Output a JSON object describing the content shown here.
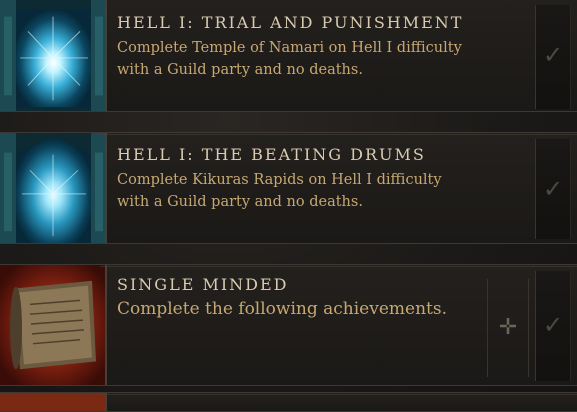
{
  "achievements": [
    {
      "title": "Hell I: Trial and Punishment",
      "description": "Complete Temple of Namari on Hell I difficulty with a Guild party and no deaths.",
      "icon": "portal-icon",
      "completed_icon": "checkmark-icon",
      "check_glyph": "✓"
    },
    {
      "title": "Hell I: The Beating Drums",
      "description": "Complete Kikuras Rapids on Hell I difficulty with a Guild party and no deaths.",
      "icon": "portal-icon",
      "completed_icon": "checkmark-icon",
      "check_glyph": "✓"
    },
    {
      "title": "Single Minded",
      "description": "Complete the following achievements.",
      "icon": "scroll-icon",
      "completed_icon": "checkmark-icon",
      "check_glyph": "✓",
      "move_icon": "move-cross-icon",
      "move_glyph": "✛"
    }
  ],
  "colors": {
    "title": "#d8cbb0",
    "description": "#c7a872",
    "portal_glow": "#7fe0ff",
    "scroll_bg": "#8a2a14"
  }
}
